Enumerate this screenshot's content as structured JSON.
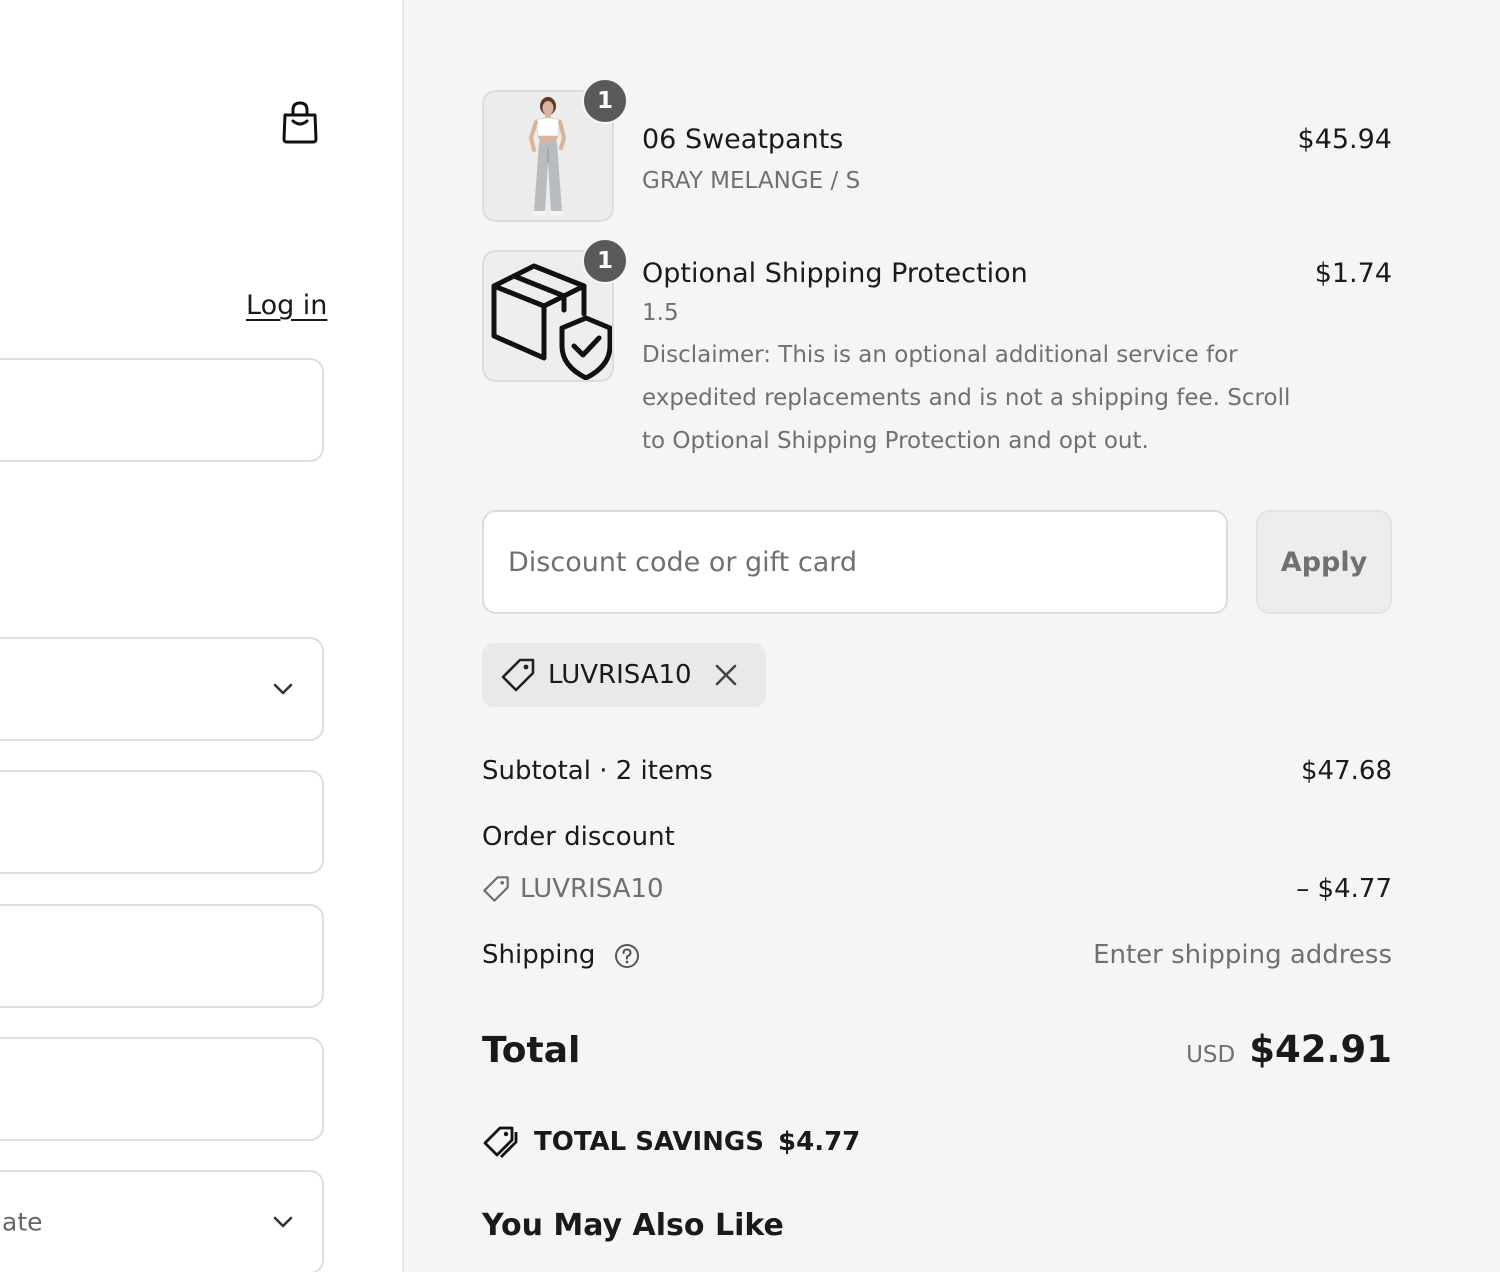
{
  "header": {
    "cart_icon": "shopping-bag-icon",
    "login_label": "Log in"
  },
  "left_form": {
    "region_field_text": "ate"
  },
  "order": {
    "items": [
      {
        "name": "06 Sweatpants",
        "variant": "GRAY MELANGE / S",
        "price": "$45.94",
        "quantity": "1"
      },
      {
        "name": "Optional Shipping Protection",
        "variant": "1.5",
        "disclaimer": "Disclaimer: This is an optional additional service for expedited replacements and is not a shipping fee. Scroll to Optional Shipping Protection and opt out.",
        "price": "$1.74",
        "quantity": "1"
      }
    ],
    "discount": {
      "placeholder": "Discount code or gift card",
      "apply_label": "Apply",
      "applied_code": "LUVRISA10"
    },
    "summary": {
      "subtotal_label": "Subtotal · 2 items",
      "subtotal_value": "$47.68",
      "order_discount_label": "Order discount",
      "order_discount_code": "LUVRISA10",
      "order_discount_value": "– $4.77",
      "shipping_label": "Shipping",
      "shipping_value": "Enter shipping address",
      "total_label": "Total",
      "total_currency": "USD",
      "total_value": "$42.91",
      "savings_label": "TOTAL SAVINGS",
      "savings_value": "$4.77"
    },
    "recommendations_title": "You May Also Like"
  }
}
